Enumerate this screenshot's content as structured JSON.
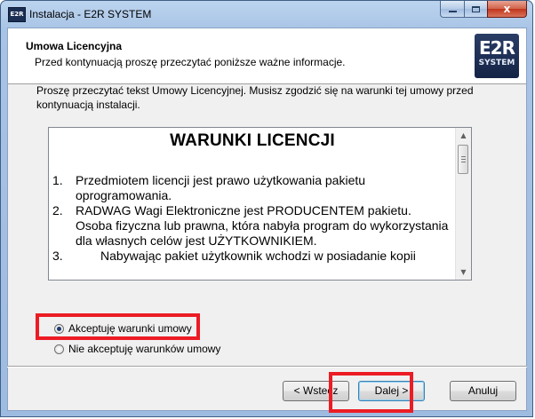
{
  "window": {
    "app_icon_text": "E2R",
    "title": "Instalacja - E2R SYSTEM",
    "close_glyph": "x"
  },
  "header": {
    "title": "Umowa Licencyjna",
    "subtitle": "Przed kontynuacją proszę przeczytać poniższe ważne informacje.",
    "logo_main": "E2R",
    "logo_sub": "SYSTEM"
  },
  "intro_text": "Proszę przeczytać tekst Umowy Licencyjnej. Musisz zgodzić się na warunki tej umowy przed kontynuacją instalacji.",
  "license": {
    "heading": "WARUNKI LICENCJI",
    "items": [
      {
        "num": "1.",
        "text": "Przedmiotem licencji jest prawo użytkowania pakietu oprogramowania."
      },
      {
        "num": "2.",
        "text": "RADWAG Wagi Elektroniczne jest PRODUCENTEM pakietu. Osoba fizyczna lub prawna, która nabyła program do wykorzystania dla własnych celów jest UŻYTKOWNIKIEM."
      },
      {
        "num": "3.",
        "text": "Nabywając pakiet użytkownik wchodzi w posiadanie kopii"
      }
    ]
  },
  "scrollbar": {
    "up_glyph": "▲",
    "down_glyph": "▼"
  },
  "options": {
    "accept": {
      "label": "Akceptuję warunki umowy",
      "checked": true
    },
    "decline": {
      "label": "Nie akceptuję warunków umowy",
      "checked": false
    }
  },
  "buttons": {
    "back": "< Wstecz",
    "next": "Dalej >",
    "cancel": "Anuluj"
  },
  "colors": {
    "highlight": "#ec1c24",
    "window_frame": "#a7c3e5",
    "close_button": "#c1351c"
  }
}
